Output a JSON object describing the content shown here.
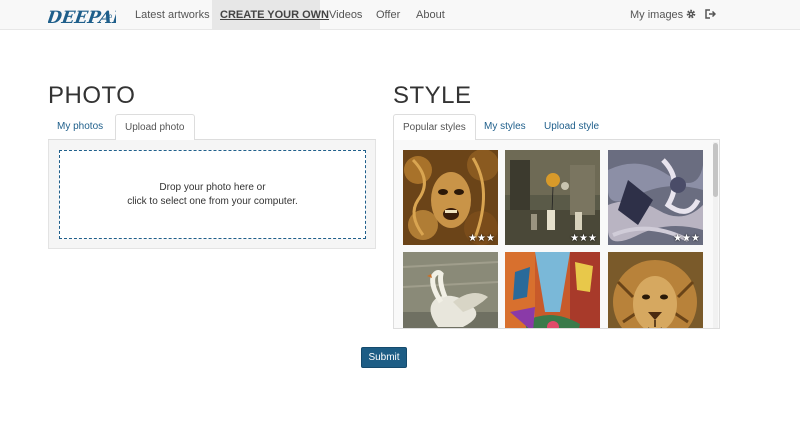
{
  "nav": {
    "logo_text": "DEEPART.io",
    "items": [
      {
        "label": "Latest artworks"
      },
      {
        "label": "CREATE YOUR OWN"
      },
      {
        "label": "Videos"
      },
      {
        "label": "Offer"
      },
      {
        "label": "About"
      }
    ],
    "my_images": "My images",
    "icons": [
      "gear-icon",
      "sign-out-icon"
    ]
  },
  "photo": {
    "title": "PHOTO",
    "tabs": [
      "My photos",
      "Upload photo"
    ],
    "active_tab": "Upload photo",
    "drop_line1": "Drop your photo here or",
    "drop_line2": "click to select one from your computer."
  },
  "style": {
    "title": "STYLE",
    "tabs": [
      "Popular styles",
      "My styles",
      "Upload style"
    ],
    "active_tab": "Popular styles",
    "thumbnails": [
      {
        "rating": "★★★"
      },
      {
        "rating": "★★★"
      },
      {
        "rating": "★★★"
      },
      {
        "rating": ""
      },
      {
        "rating": ""
      },
      {
        "rating": ""
      }
    ]
  },
  "submit_label": "Submit",
  "colors": {
    "link": "#1f5f8b",
    "button": "#1d5d85",
    "navbar": "#f8f8f8"
  }
}
